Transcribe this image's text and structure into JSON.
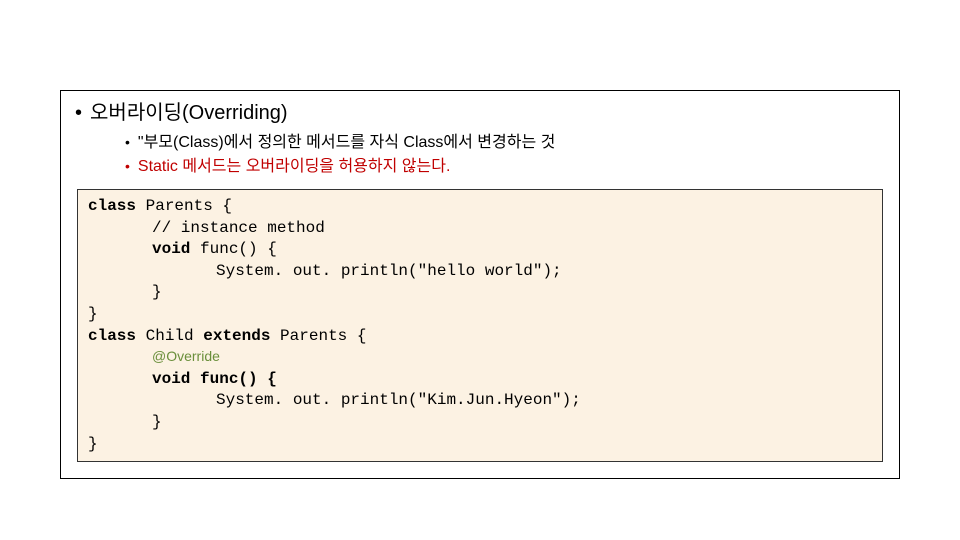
{
  "slide": {
    "title": "오버라이딩(Overriding)",
    "points": [
      {
        "text": "\"부모(Class)에서 정의한 메서드를 자식 Class에서 변경하는 것",
        "red": false
      },
      {
        "text": "Static 메서드는 오버라이딩을 허용하지 않는다.",
        "red": true
      }
    ],
    "code": {
      "l1a": "class",
      "l1b": " Parents {",
      "l2": "// instance method",
      "l3a": "void",
      "l3b": " func() {",
      "l4": "System. out. println(\"hello world\");",
      "l5": "}",
      "l6": "}",
      "l7a": "class",
      "l7b": " Child ",
      "l7c": "extends",
      "l7d": " Parents {",
      "l8": "@Override",
      "l9a": "void",
      "l9b": " func() {",
      "l10": "System. out. println(\"Kim.Jun.Hyeon\");",
      "l11": "}",
      "l12": "}"
    }
  }
}
